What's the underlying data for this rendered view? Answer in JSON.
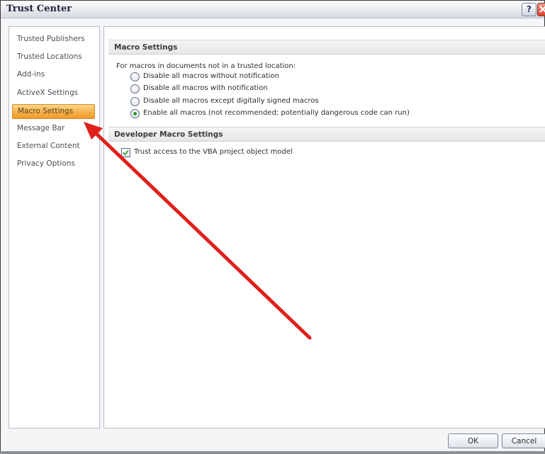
{
  "window": {
    "title": "Trust Center",
    "help_label": "?"
  },
  "sidebar": {
    "items": [
      {
        "label": "Trusted Publishers"
      },
      {
        "label": "Trusted Locations"
      },
      {
        "label": "Add-ins"
      },
      {
        "label": "ActiveX Settings"
      },
      {
        "label": "Macro Settings",
        "selected": true
      },
      {
        "label": "Message Bar"
      },
      {
        "label": "External Content"
      },
      {
        "label": "Privacy Options"
      }
    ]
  },
  "macro_settings": {
    "header": "Macro Settings",
    "intro": "For macros in documents not in a trusted location:",
    "options": [
      {
        "label": "Disable all macros without notification",
        "checked": false
      },
      {
        "label": "Disable all macros with notification",
        "checked": false
      },
      {
        "label": "Disable all macros except digitally signed macros",
        "checked": false
      },
      {
        "label": "Enable all macros (not recommended; potentially dangerous code can run)",
        "checked": true
      }
    ]
  },
  "developer_settings": {
    "header": "Developer Macro Settings",
    "trust_vba_label": "Trust access to the VBA project object model",
    "trust_vba_checked": true
  },
  "buttons": {
    "ok": "OK",
    "cancel": "Cancel"
  },
  "colors": {
    "selected_nav": "#f7b04c",
    "annotation_arrow": "#e0201b",
    "radio_selected": "#2b9a2b"
  },
  "icons": {
    "help": "help-icon",
    "close": "close-icon",
    "checkmark": "checkmark-icon",
    "annotation": "red-arrow-annotation"
  }
}
